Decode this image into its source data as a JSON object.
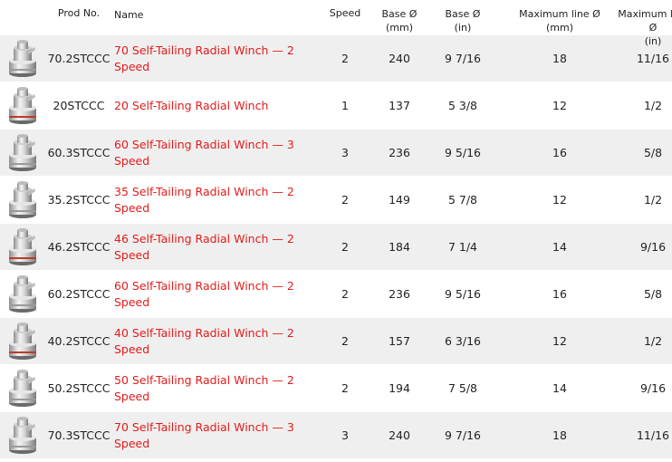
{
  "header": {
    "prod_no": "Prod No.",
    "name": "Name",
    "speed": "Speed",
    "base_mm_1": "Base Ø",
    "base_mm_2": "(mm)",
    "base_in_1": "Base Ø",
    "base_in_2": "(in)",
    "max_mm_1": "Maximum line Ø",
    "max_mm_2": "(mm)",
    "max_in_1": "Maximum line Ø",
    "max_in_2": "(in)"
  },
  "rows": [
    {
      "prod": "70.2STCCC",
      "name": "70 Self-Tailing Radial Winch — 2 Speed",
      "speed": "2",
      "base_mm": "240",
      "base_in": "9 7/16",
      "max_mm": "18",
      "max_in": "11/16",
      "band": "#9a9a9a"
    },
    {
      "prod": "20STCCC",
      "name": "20 Self-Tailing Radial Winch",
      "speed": "1",
      "base_mm": "137",
      "base_in": "5 3/8",
      "max_mm": "12",
      "max_in": "1/2",
      "band": "#c0392b"
    },
    {
      "prod": "60.3STCCC",
      "name": "60 Self-Tailing Radial Winch — 3 Speed",
      "speed": "3",
      "base_mm": "236",
      "base_in": "9 5/16",
      "max_mm": "16",
      "max_in": "5/8",
      "band": "#9a9a9a"
    },
    {
      "prod": "35.2STCCC",
      "name": "35 Self-Tailing Radial Winch — 2 Speed",
      "speed": "2",
      "base_mm": "149",
      "base_in": "5 7/8",
      "max_mm": "12",
      "max_in": "1/2",
      "band": "#9a9a9a"
    },
    {
      "prod": "46.2STCCC",
      "name": "46 Self-Tailing Radial Winch — 2 Speed",
      "speed": "2",
      "base_mm": "184",
      "base_in": "7 1/4",
      "max_mm": "14",
      "max_in": "9/16",
      "band": "#c0392b"
    },
    {
      "prod": "60.2STCCC",
      "name": "60 Self-Tailing Radial Winch — 2 Speed",
      "speed": "2",
      "base_mm": "236",
      "base_in": "9 5/16",
      "max_mm": "16",
      "max_in": "5/8",
      "band": "#9a9a9a"
    },
    {
      "prod": "40.2STCCC",
      "name": "40 Self-Tailing Radial Winch — 2 Speed",
      "speed": "2",
      "base_mm": "157",
      "base_in": "6 3/16",
      "max_mm": "12",
      "max_in": "1/2",
      "band": "#c0392b"
    },
    {
      "prod": "50.2STCCC",
      "name": "50 Self-Tailing Radial Winch — 2 Speed",
      "speed": "2",
      "base_mm": "194",
      "base_in": "7 5/8",
      "max_mm": "14",
      "max_in": "9/16",
      "band": "#9a9a9a"
    },
    {
      "prod": "70.3STCCC",
      "name": "70 Self-Tailing Radial Winch — 3 Speed",
      "speed": "3",
      "base_mm": "240",
      "base_in": "9 7/16",
      "max_mm": "18",
      "max_in": "11/16",
      "band": "#9a9a9a"
    }
  ],
  "colors": {
    "link": "#e31b1b",
    "row_shade": "#efefef"
  },
  "icons": {
    "product": "winch-thumbnail-icon"
  }
}
